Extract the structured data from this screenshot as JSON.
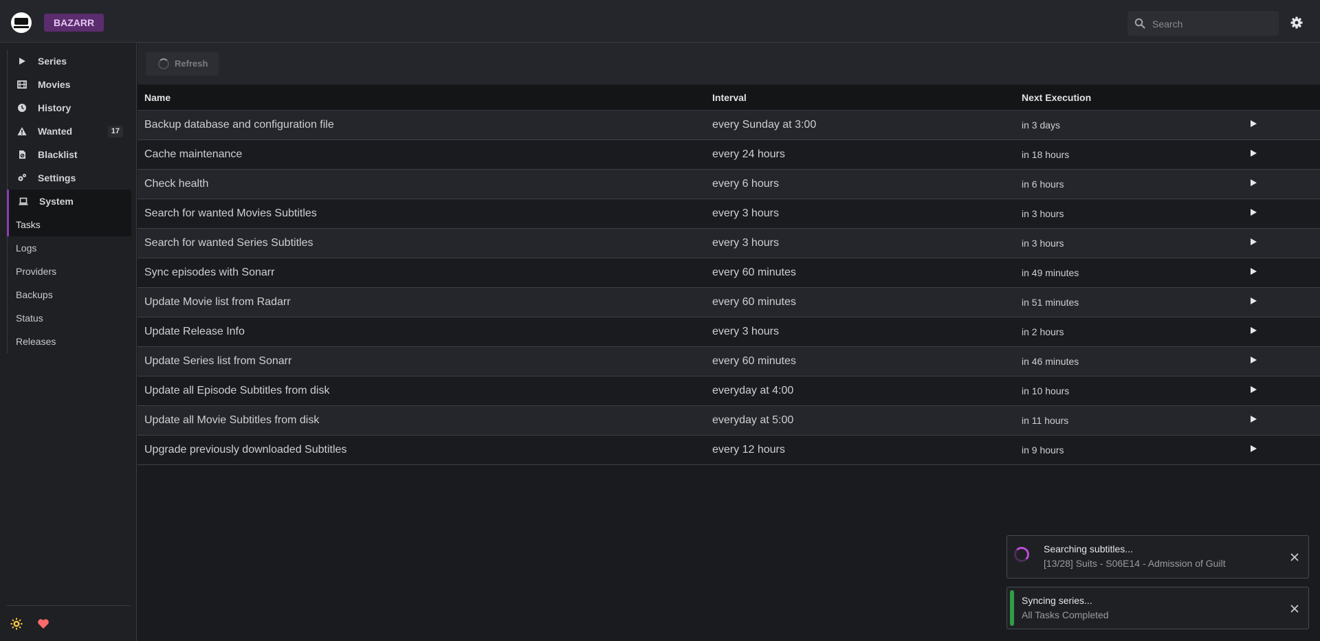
{
  "header": {
    "brand": "BAZARR",
    "search_placeholder": "Search"
  },
  "sidebar": {
    "items": [
      {
        "label": "Series",
        "icon": "play-icon"
      },
      {
        "label": "Movies",
        "icon": "film-icon"
      },
      {
        "label": "History",
        "icon": "clock-icon"
      },
      {
        "label": "Wanted",
        "icon": "warning-icon",
        "badge": "17"
      },
      {
        "label": "Blacklist",
        "icon": "file-ban-icon"
      },
      {
        "label": "Settings",
        "icon": "gears-icon"
      },
      {
        "label": "System",
        "icon": "laptop-icon"
      }
    ],
    "system_sub": [
      "Tasks",
      "Logs",
      "Providers",
      "Backups",
      "Status",
      "Releases"
    ]
  },
  "toolbar": {
    "refresh_label": "Refresh"
  },
  "table": {
    "headers": [
      "Name",
      "Interval",
      "Next Execution"
    ],
    "rows": [
      [
        "Backup database and configuration file",
        "every Sunday at 3:00",
        "in 3 days"
      ],
      [
        "Cache maintenance",
        "every 24 hours",
        "in 18 hours"
      ],
      [
        "Check health",
        "every 6 hours",
        "in 6 hours"
      ],
      [
        "Search for wanted Movies Subtitles",
        "every 3 hours",
        "in 3 hours"
      ],
      [
        "Search for wanted Series Subtitles",
        "every 3 hours",
        "in 3 hours"
      ],
      [
        "Sync episodes with Sonarr",
        "every 60 minutes",
        "in 49 minutes"
      ],
      [
        "Update Movie list from Radarr",
        "every 60 minutes",
        "in 51 minutes"
      ],
      [
        "Update Release Info",
        "every 3 hours",
        "in 2 hours"
      ],
      [
        "Update Series list from Sonarr",
        "every 60 minutes",
        "in 46 minutes"
      ],
      [
        "Update all Episode Subtitles from disk",
        "everyday at 4:00",
        "in 10 hours"
      ],
      [
        "Update all Movie Subtitles from disk",
        "everyday at 5:00",
        "in 11 hours"
      ],
      [
        "Upgrade previously downloaded Subtitles",
        "every 12 hours",
        "in 9 hours"
      ]
    ]
  },
  "notifications": {
    "searching": {
      "title": "Searching subtitles...",
      "subtitle": "[13/28] Suits - S06E14 - Admission of Guilt"
    },
    "syncing": {
      "title": "Syncing series...",
      "subtitle": "All Tasks Completed"
    }
  },
  "colors": {
    "accent": "#8b3fb5",
    "brand_bg": "#5b2d6e",
    "success": "#2f9e44",
    "spinner": "#be4bdb"
  }
}
